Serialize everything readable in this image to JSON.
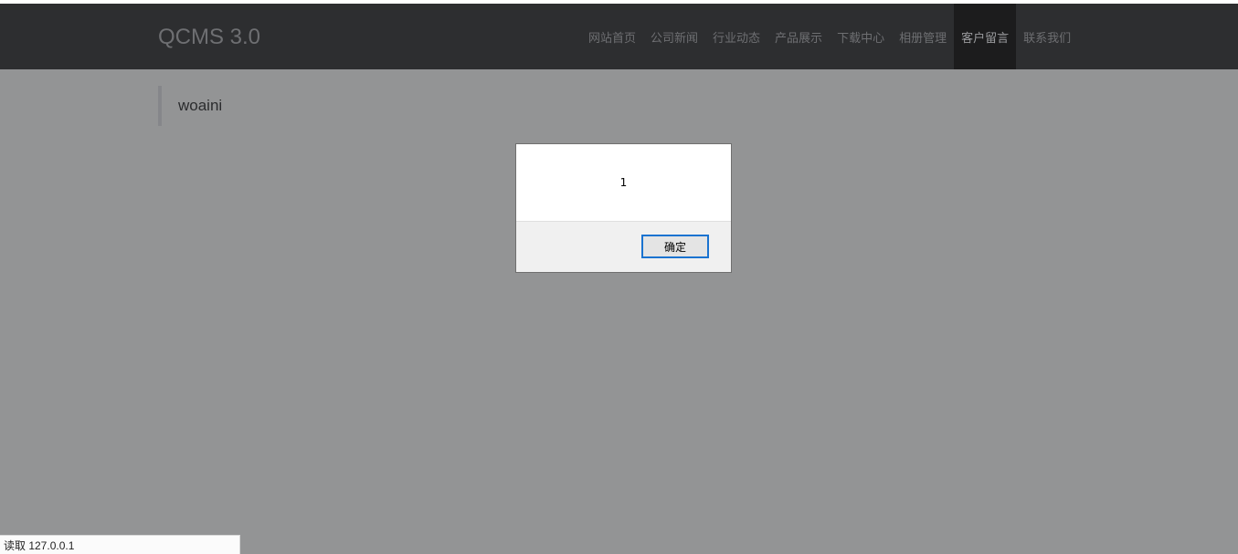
{
  "site": {
    "brand": "QCMS 3.0"
  },
  "nav": {
    "items": [
      {
        "label": "网站首页"
      },
      {
        "label": "公司新闻"
      },
      {
        "label": "行业动态"
      },
      {
        "label": "产品展示"
      },
      {
        "label": "下载中心"
      },
      {
        "label": "相册管理"
      },
      {
        "label": "客户留言",
        "active": true
      },
      {
        "label": "联系我们"
      }
    ]
  },
  "page": {
    "heading": "woaini"
  },
  "alert": {
    "message": "1",
    "ok_label": "确定"
  },
  "status": {
    "text": "读取 127.0.0.1"
  },
  "colors": {
    "overlay_bg": "#939495",
    "navbar_bg": "#2d2e30",
    "active_nav_bg": "#1c1c1d",
    "button_focus_border": "#1a73d0"
  }
}
